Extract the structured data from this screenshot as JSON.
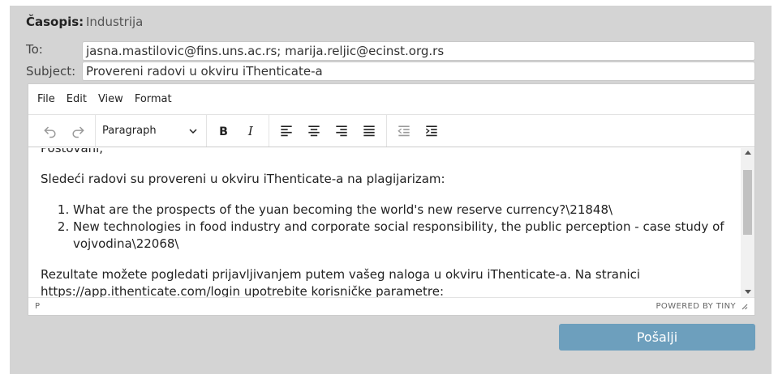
{
  "journal": {
    "label": "Časopis:",
    "value": "Industrija"
  },
  "email": {
    "to_label": "To:",
    "to_value": "jasna.mastilovic@fins.uns.ac.rs; marija.reljic@ecinst.org.rs",
    "subject_label": "Subject:",
    "subject_value": "Provereni radovi u okviru iThenticate-a"
  },
  "editor": {
    "menu": [
      "File",
      "Edit",
      "View",
      "Format"
    ],
    "block_format": "Paragraph",
    "toolbar_icons": [
      "undo-icon",
      "redo-icon",
      "bold-icon",
      "italic-icon",
      "align-left-icon",
      "align-center-icon",
      "align-right-icon",
      "align-justify-icon",
      "outdent-icon",
      "indent-icon"
    ],
    "body": {
      "greeting": "Poštovani,",
      "intro": "Sledeći radovi su provereni u okviru iThenticate-a na plagijarizam:",
      "papers": [
        "What are the prospects of the yuan becoming the world's new reserve currency?\\21848\\",
        "New technologies in food industry and corporate social responsibility, the public perception - case study of vojvodina\\22068\\"
      ],
      "results_line": "Rezultate možete pogledati prijavljivanjem putem vašeg naloga u okviru iThenticate-a. Na stranici",
      "url_line": "https://app.ithenticate.com/login upotrebite korisničke parametre:"
    },
    "status_path": "P",
    "branding": "POWERED BY TINY"
  },
  "send_label": "Pošalji",
  "colors": {
    "panel": "#d4d4d4",
    "send_button": "#6d9fbd"
  }
}
